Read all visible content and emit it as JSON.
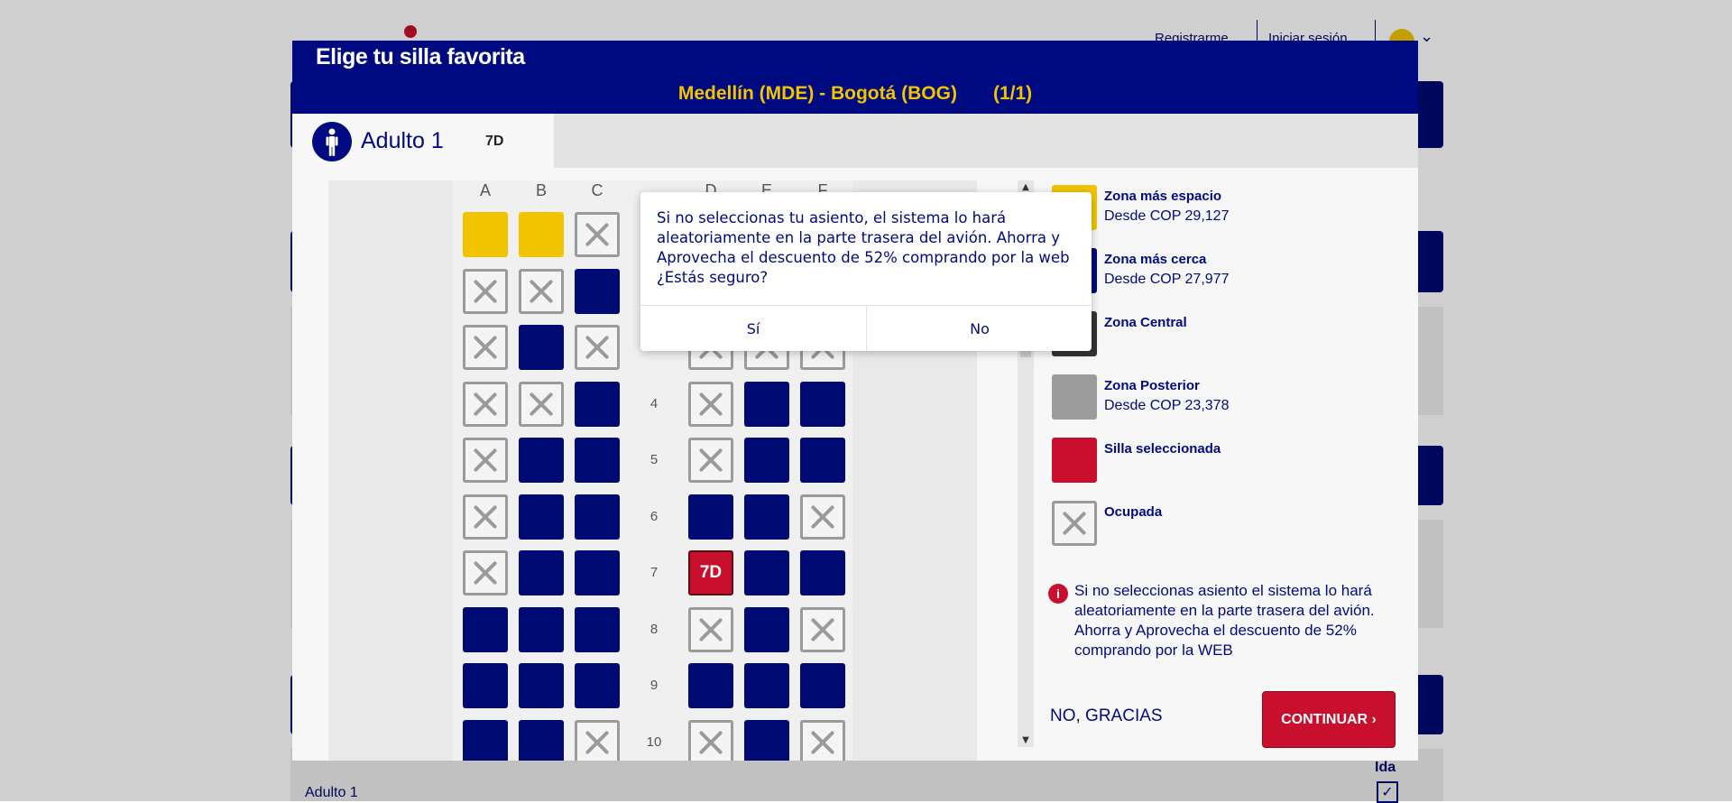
{
  "background": {
    "nav_register": "Registrarme",
    "nav_login": "Iniciar sesión",
    "adult_label": "Adulto 1",
    "ida_label": "Ida",
    "checkmark": "✓",
    "chevron": "⌄"
  },
  "modal": {
    "title": "Elige tu silla favorita",
    "route": "Medellín (MDE) - Bogotá (BOG)",
    "segment": "(1/1)",
    "passenger_name": "Adulto 1",
    "passenger_seat": "7D"
  },
  "seatmap": {
    "columns_left": [
      "A",
      "B",
      "C"
    ],
    "columns_right": [
      "D",
      "E",
      "F"
    ],
    "rows": [
      {
        "n": "",
        "seats": [
          "yellow",
          "yellow",
          "occupied",
          "hidden",
          "hidden",
          "hidden"
        ]
      },
      {
        "n": "",
        "seats": [
          "occupied",
          "occupied",
          "blue",
          "hidden",
          "hidden",
          "hidden"
        ]
      },
      {
        "n": "",
        "seats": [
          "occupied",
          "blue",
          "occupied",
          "occupied",
          "occupied",
          "occupied"
        ]
      },
      {
        "n": "4",
        "seats": [
          "occupied",
          "occupied",
          "blue",
          "occupied",
          "blue",
          "blue"
        ]
      },
      {
        "n": "5",
        "seats": [
          "occupied",
          "blue",
          "blue",
          "occupied",
          "blue",
          "blue"
        ]
      },
      {
        "n": "6",
        "seats": [
          "occupied",
          "blue",
          "blue",
          "blue",
          "blue",
          "occupied"
        ]
      },
      {
        "n": "7",
        "seats": [
          "occupied",
          "blue",
          "blue",
          "selected",
          "blue",
          "blue"
        ]
      },
      {
        "n": "8",
        "seats": [
          "blue",
          "blue",
          "blue",
          "occupied",
          "blue",
          "occupied"
        ]
      },
      {
        "n": "9",
        "seats": [
          "blue",
          "blue",
          "blue",
          "blue",
          "blue",
          "blue"
        ]
      },
      {
        "n": "10",
        "seats": [
          "blue",
          "blue",
          "occupied",
          "occupied",
          "blue",
          "occupied"
        ]
      }
    ],
    "selected_label": "7D"
  },
  "legend": [
    {
      "name": "Zona más espacio",
      "price": "Desde COP 29,127",
      "color": "#f2c400"
    },
    {
      "name": "Zona más cerca",
      "price": "Desde COP 27,977",
      "color": "#000a73"
    },
    {
      "name": "Zona Central",
      "price": "",
      "color": "#333333"
    },
    {
      "name": "Zona Posterior",
      "price": "Desde COP 23,378",
      "color": "#9b9b9b"
    },
    {
      "name": "Silla seleccionada",
      "price": "",
      "color": "#c8102e"
    },
    {
      "name": "Ocupada",
      "price": "",
      "color": "occupied"
    }
  ],
  "info": {
    "icon": "i",
    "text": "Si no seleccionas asiento el sistema lo hará aleatoriamente en la parte trasera del avión. Ahorra y Aprovecha el descuento de 52% comprando por la WEB"
  },
  "actions": {
    "no_thanks": "NO, GRACIAS",
    "continue": "CONTINUAR ›"
  },
  "dialog": {
    "message": "Si no seleccionas tu asiento, el sistema lo hará aleatoriamente en la parte trasera del avión. Ahorra y Aprovecha el descuento de 52% comprando por la web ¿Estás seguro?",
    "yes": "Sí",
    "no": "No"
  },
  "colors": {
    "brand_navy": "#000a80",
    "brand_yellow": "#f2c400",
    "brand_red": "#c8102e"
  }
}
